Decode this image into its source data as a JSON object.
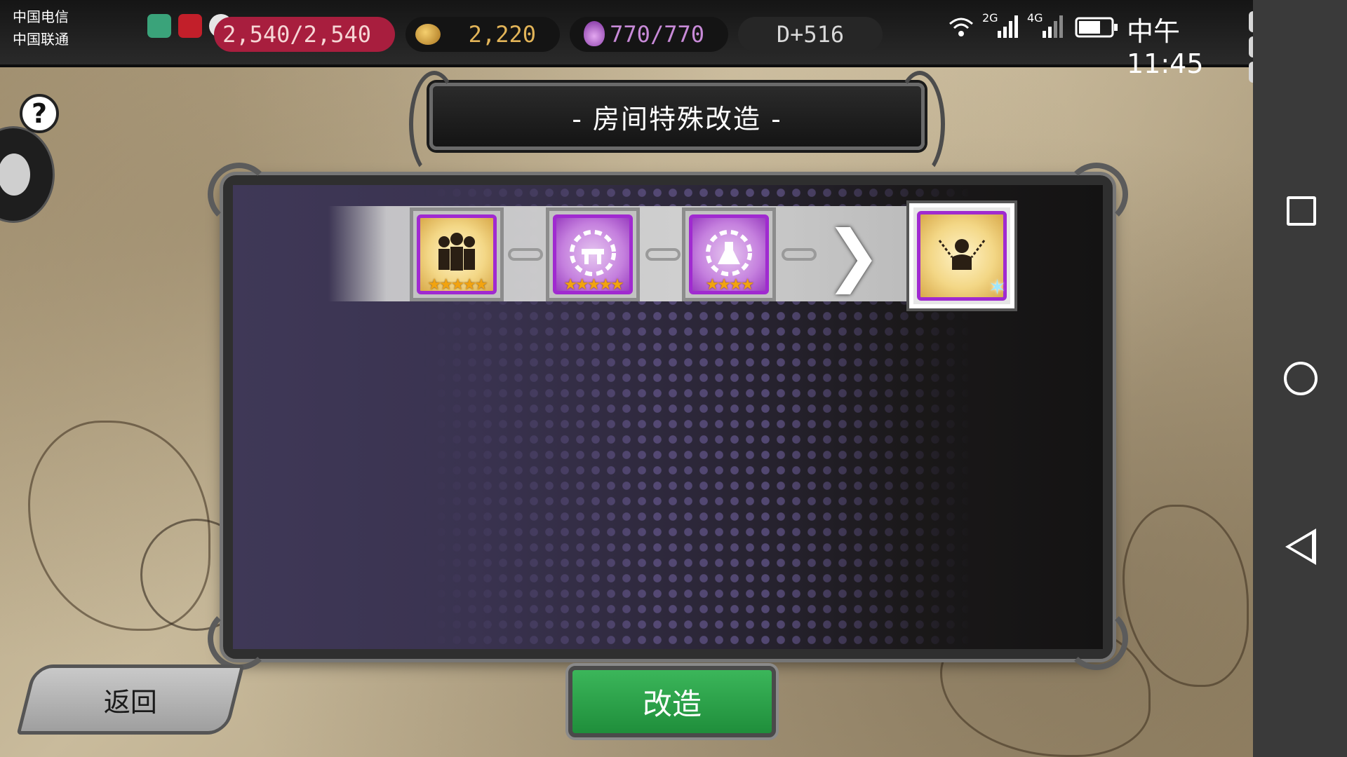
{
  "statusbar": {
    "carrier1": "中国电信",
    "carrier2": "中国联通",
    "time": "中午11:45",
    "network_labels": [
      "2G",
      "4G"
    ]
  },
  "resources": {
    "hp": "2,540/2,540",
    "gold": "2,220",
    "mana": "770/770",
    "day": "D+516"
  },
  "header": {
    "title": "-  房间特殊改造  -"
  },
  "recipe": {
    "ingredients": [
      {
        "icon": "prisoner-group-icon",
        "stars": "★★★★★"
      },
      {
        "icon": "workbench-gear-icon",
        "stars": "★★★★★"
      },
      {
        "icon": "laboratory-gear-icon",
        "stars": "★★★★"
      }
    ],
    "result": {
      "icon": "chained-prisoner-icon"
    }
  },
  "buttons": {
    "back": "返回",
    "modify": "改造",
    "help": "?"
  },
  "colors": {
    "accent_purple": "#a02ad0",
    "modify_green": "#2ea44f",
    "hp_red": "#a81e3e"
  }
}
